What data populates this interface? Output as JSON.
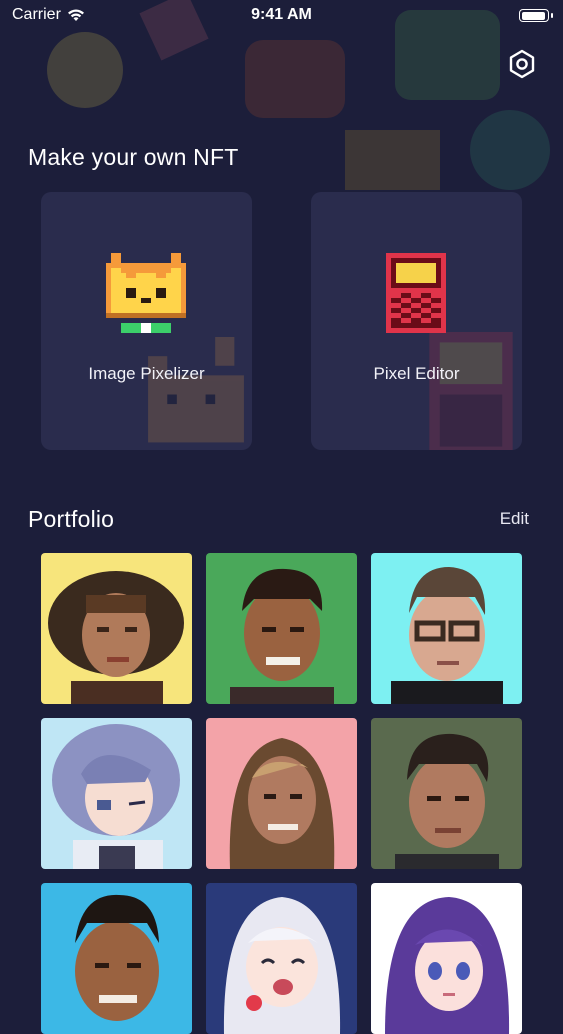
{
  "status_bar": {
    "carrier": "Carrier",
    "time": "9:41 AM",
    "wifi_icon": "wifi-icon",
    "battery_icon": "battery-icon"
  },
  "header": {
    "settings_icon": "settings-icon"
  },
  "create_section": {
    "title": "Make your own NFT",
    "tools": [
      {
        "label": "Image Pixelizer",
        "icon": "pixel-cat-icon"
      },
      {
        "label": "Pixel Editor",
        "icon": "pixel-device-icon"
      }
    ]
  },
  "portfolio": {
    "title": "Portfolio",
    "edit_label": "Edit",
    "items": [
      {
        "bg": "#f7e57c",
        "desc": "pixel portrait man with hat"
      },
      {
        "bg": "#4aa85a",
        "desc": "pixel portrait smiling man"
      },
      {
        "bg": "#7df0f2",
        "desc": "pixel portrait man with glasses"
      },
      {
        "bg": "#bfe6f5",
        "desc": "pixel portrait anime girl winking"
      },
      {
        "bg": "#f3a3a8",
        "desc": "pixel portrait woman long hair"
      },
      {
        "bg": "#5a6a4e",
        "desc": "pixel portrait man dark hair"
      },
      {
        "bg": "#3cb8e6",
        "desc": "pixel portrait man smiling"
      },
      {
        "bg": "#2a3a7a",
        "desc": "pixel portrait anime girl white hair"
      },
      {
        "bg": "#ffffff",
        "desc": "pixel portrait anime girl purple hair"
      }
    ]
  },
  "colors": {
    "background": "#1c1e3a",
    "card": "#2a2c4d",
    "text": "#ffffff"
  }
}
